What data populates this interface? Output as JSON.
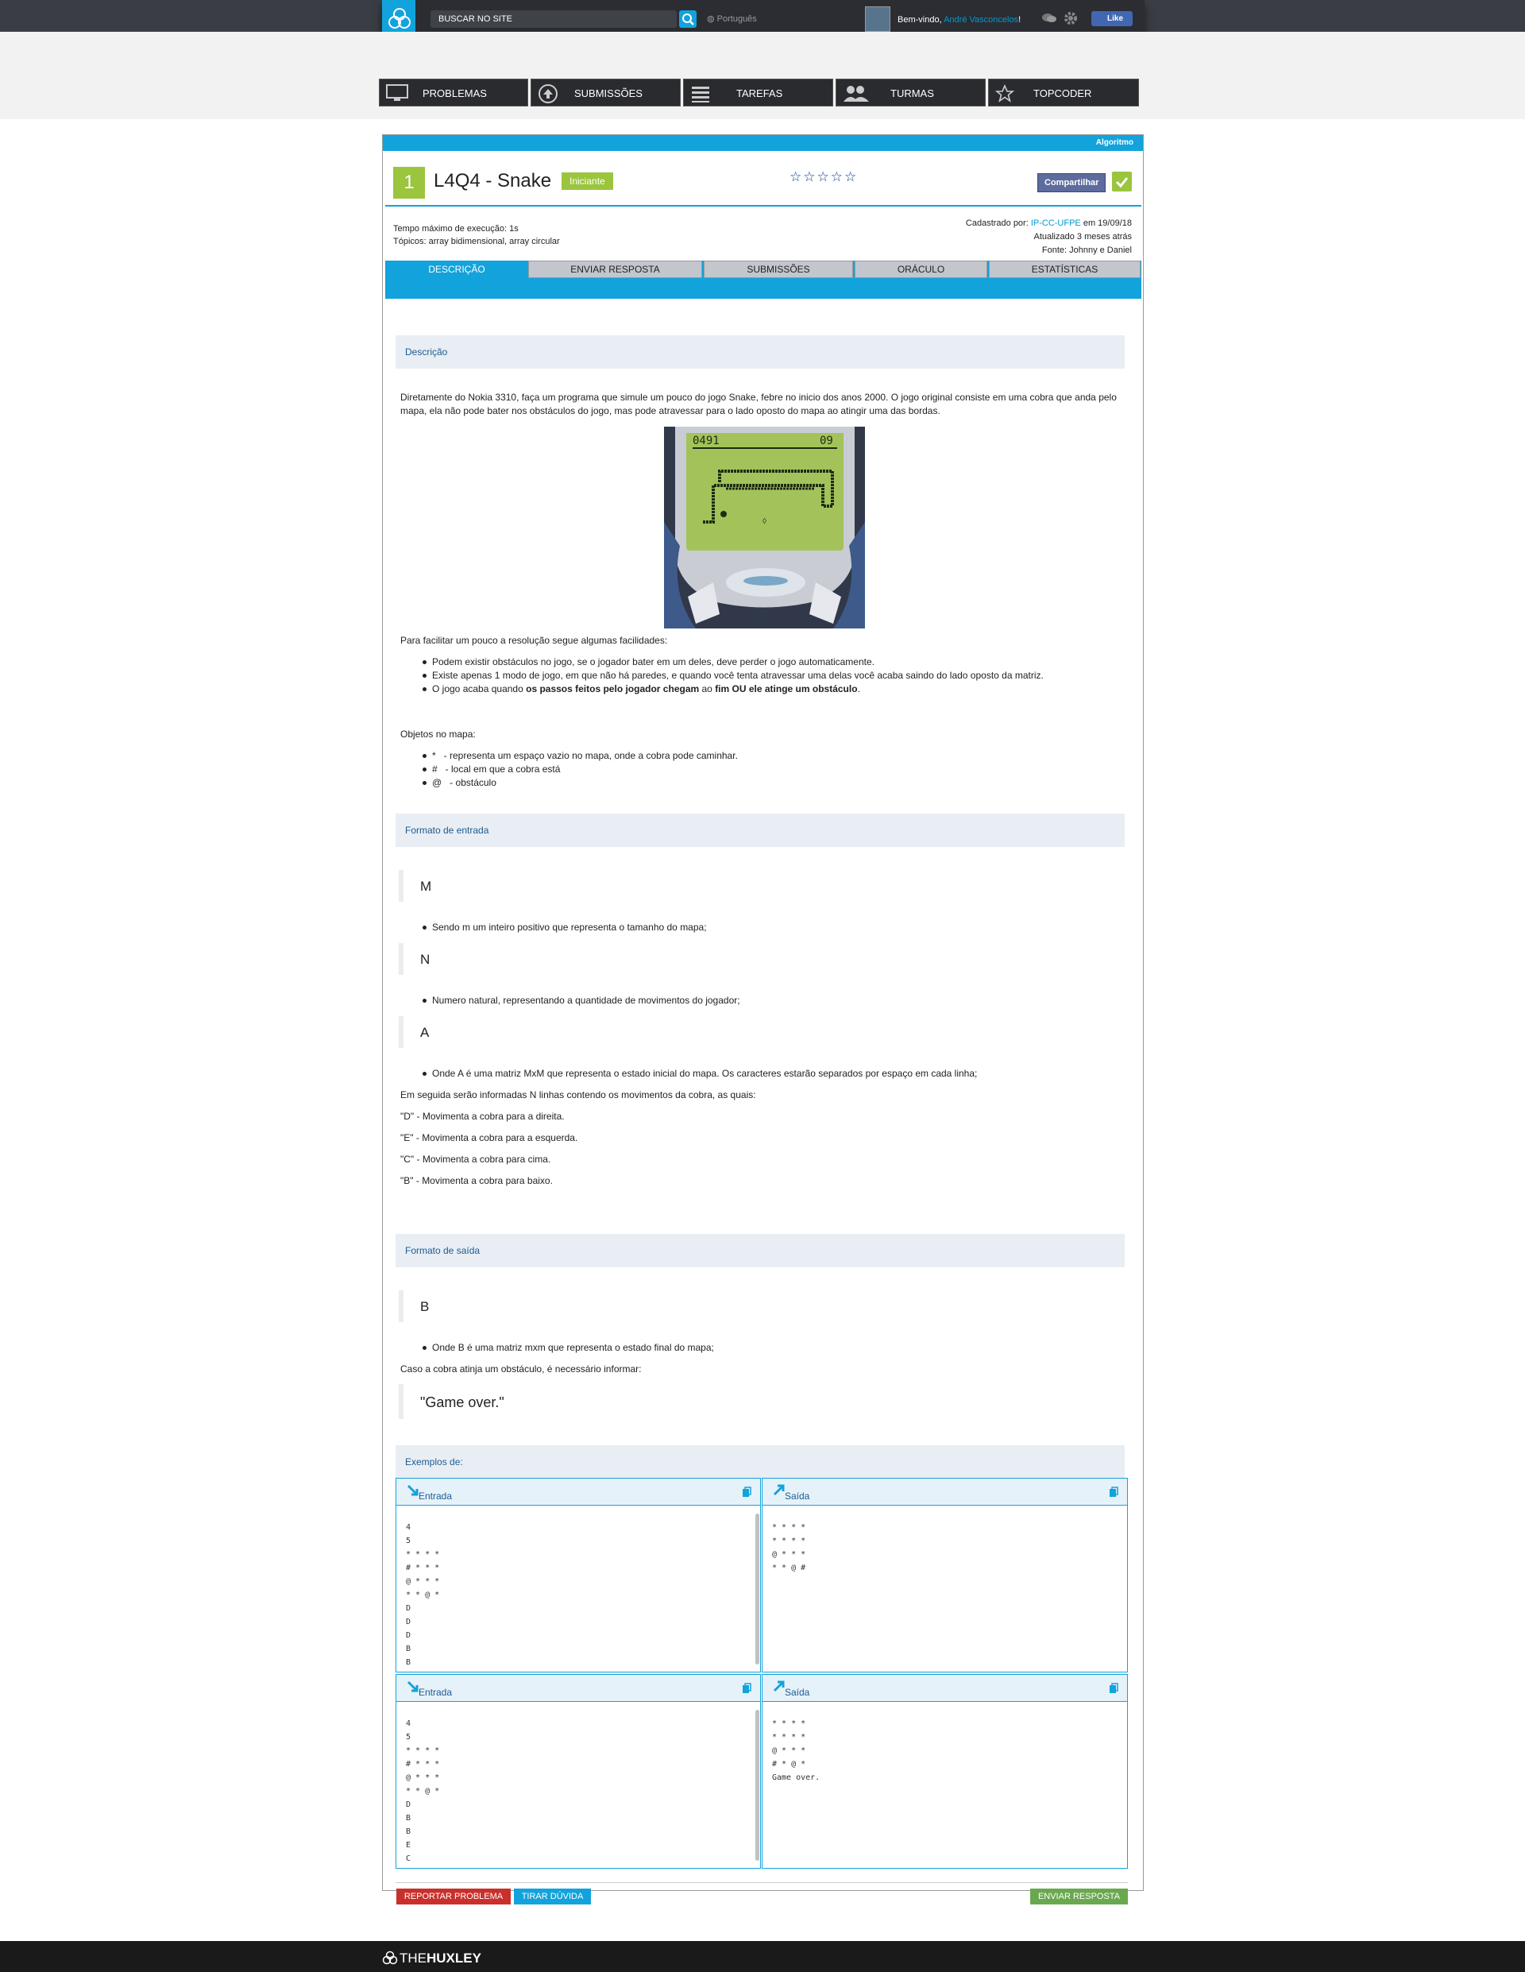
{
  "topbar": {
    "search_placeholder": "BUSCAR NO SITE",
    "language": "Português",
    "welcome_prefix": "Bem-vindo, ",
    "user_name": "André Vasconcelos",
    "welcome_suffix": "!",
    "like_label": "Like"
  },
  "nav": [
    {
      "label": "PROBLEMAS",
      "icon": "monitor-icon"
    },
    {
      "label": "SUBMISSÕES",
      "icon": "upload-circle-icon"
    },
    {
      "label": "TAREFAS",
      "icon": "list-icon"
    },
    {
      "label": "TURMAS",
      "icon": "group-icon"
    },
    {
      "label": "TOPCODER",
      "icon": "star-icon"
    }
  ],
  "problem": {
    "category": "Algoritmo",
    "level": "1",
    "title": "L4Q4 - Snake",
    "difficulty": "Iniciante",
    "stars": "☆☆☆☆☆",
    "share_label": "Compartilhar",
    "time_limit": "Tempo máximo de execução: 1s",
    "topics": "Tópicos: array bidimensional, array circular",
    "registered_prefix": "Cadastrado por: ",
    "registered_by": "IP-CC-UFPE",
    "registered_suffix": " em 19/09/18",
    "updated": "Atualizado 3 meses atrás",
    "source": "Fonte: Johnny e Daniel"
  },
  "tabs": [
    "DESCRIÇÃO",
    "ENVIAR RESPOSTA",
    "SUBMISSÕES",
    "ORÁCULO",
    "ESTATÍSTICAS"
  ],
  "description": {
    "heading": "Descrição",
    "intro1": "Diretamente do Nokia 3310, faça um programa que simule um pouco do jogo Snake, febre no inicio dos anos 2000. O jogo original consiste em uma cobra que anda pelo",
    "intro2": "mapa, ela não pode bater nos obstáculos do jogo, mas pode atravessar para o lado oposto do mapa ao atingir uma das bordas.",
    "screen_score": "0491",
    "screen_lives": "09",
    "facilitate": "Para facilitar um pouco a resolução segue algumas facilidades:",
    "rules": [
      "Podem existir obstáculos no jogo, se o jogador bater em um deles, deve perder o jogo automaticamente.",
      "Existe apenas 1 modo de jogo, em que não há paredes, e quando você tenta atravessar uma delas você acaba saindo do lado oposto da matriz."
    ],
    "rule3_a": "O jogo acaba quando ",
    "rule3_b": "os passos feitos pelo jogador chegam",
    "rule3_c": " ao ",
    "rule3_d": "fim OU ele atinge um obstáculo",
    ".": ".",
    "objects_title": "Objetos no mapa:",
    "objects": [
      "*   - representa um espaço vazio no mapa, onde a cobra pode caminhar.",
      "#   - local em que a cobra está",
      "@   - obstáculo"
    ]
  },
  "input_format": {
    "heading": "Formato de entrada",
    "m": "M",
    "m_desc": "Sendo m um inteiro positivo que representa o tamanho do mapa;",
    "n": "N",
    "n_desc": "Numero natural, representando a quantidade de movimentos do jogador;",
    "a": "A",
    "a_desc": "Onde A é uma matriz MxM que representa o estado inicial do mapa. Os caracteres estarão separados por espaço em cada linha;",
    "moves_intro": "Em seguida serão informadas N linhas contendo os movimentos da cobra, as quais:",
    "moves": [
      "\"D\" - Movimenta a cobra para a direita.",
      "\"E\" - Movimenta a cobra para a esquerda.",
      "\"C\" - Movimenta a cobra para cima.",
      "\"B\" - Movimenta a cobra para baixo."
    ]
  },
  "output_format": {
    "heading": "Formato de saída",
    "b": "B",
    "b_desc": "Onde B é uma matriz mxm que representa o estado final do mapa;",
    "obstacle_note": "Caso a cobra atinja um obstáculo, é necessário informar:",
    "game_over": "\"Game over.\""
  },
  "examples": {
    "heading": "Exemplos de:",
    "input_label": "Entrada",
    "output_label": "Saída",
    "items": [
      {
        "input": [
          "4",
          "5",
          "* * * *",
          "# * * *",
          "@ * * *",
          "* * @ *",
          "D",
          "D",
          "D",
          "B",
          "B"
        ],
        "output": [
          "* * * *",
          "* * * *",
          "@ * * *",
          "* * @ #"
        ]
      },
      {
        "input": [
          "4",
          "5",
          "* * * *",
          "# * * *",
          "@ * * *",
          "* * @ *",
          "D",
          "B",
          "B",
          "E",
          "C"
        ],
        "output": [
          "* * * *",
          "* * * *",
          "@ * * *",
          "# * @ *",
          "Game over."
        ]
      }
    ]
  },
  "actions": {
    "report": "REPORTAR PROBLEMA",
    "doubt": "TIRAR DÚVIDA",
    "submit": "ENVIAR RESPOSTA"
  },
  "footer": {
    "brand_light": "THE",
    "brand_bold": "HUXLEY"
  },
  "colors": {
    "accent": "#12a3dc",
    "level_green": "#9bc53d",
    "report_red": "#c9302c",
    "submit_green": "#6aa84f"
  }
}
